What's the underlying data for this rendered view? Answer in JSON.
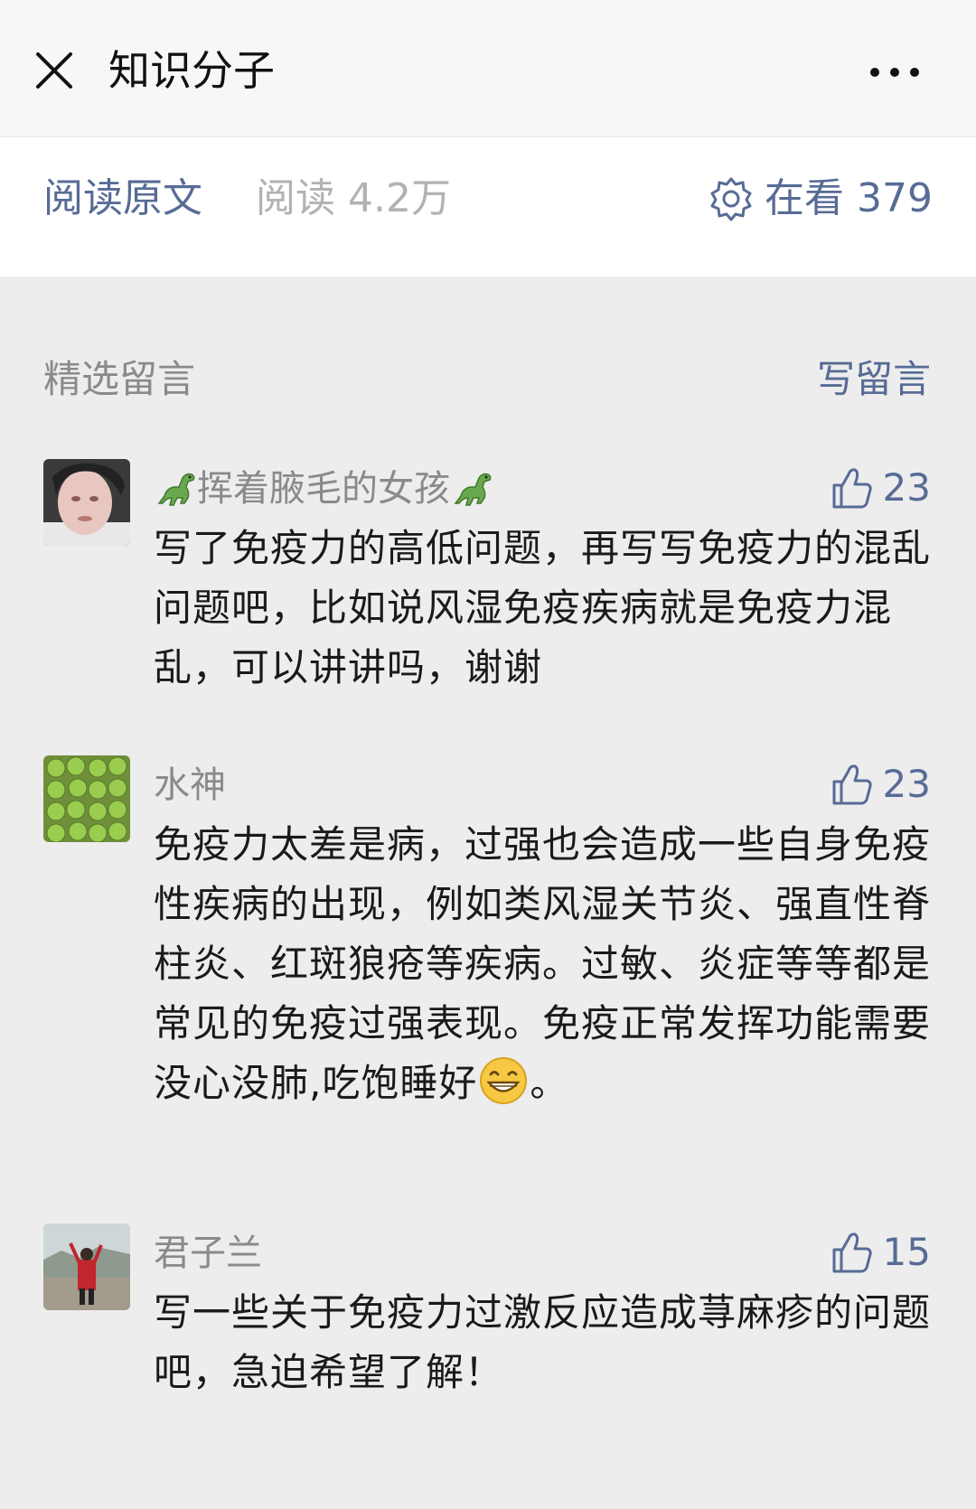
{
  "nav": {
    "title": "知识分子"
  },
  "stats": {
    "read_original": "阅读原文",
    "read_count": "阅读 4.2万",
    "watching": "在看 379"
  },
  "comments_section": {
    "title": "精选留言",
    "write": "写留言"
  },
  "comments": [
    {
      "name": "挥着腋毛的女孩",
      "likes": "23",
      "text": "写了免疫力的高低问题，再写写免疫力的混乱问题吧，比如说风湿免疫疾病就是免疫力混乱，可以讲讲吗，谢谢"
    },
    {
      "name": "水神",
      "likes": "23",
      "text": "免疫力太差是病，过强也会造成一些自身免疫性疾病的出现，例如类风湿关节炎、强直性脊柱炎、红斑狼疮等疾病。过敏、炎症等等都是常见的免疫过强表现。免疫正常发挥功能需要没心没肺,吃饱睡好",
      "text_end": "。"
    },
    {
      "name": "君子兰",
      "likes": "15",
      "text": "写一些关于免疫力过激反应造成荨麻疹的问题吧，急迫希望了解！"
    }
  ],
  "colors": {
    "link": "#576b95",
    "muted": "#8a8a8a",
    "background": "#ededed"
  },
  "icons": [
    "close-icon",
    "more-icon",
    "watching-icon",
    "thumb-up-icon",
    "dinosaur-icon",
    "grin-emoji-icon"
  ]
}
